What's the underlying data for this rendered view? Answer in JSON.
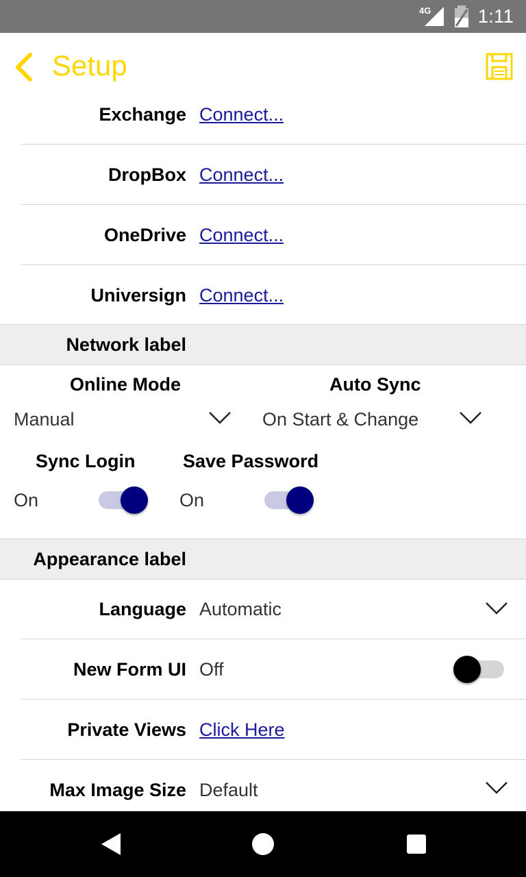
{
  "status_bar": {
    "network": "4G",
    "time": "1:11"
  },
  "app_bar": {
    "title": "Setup"
  },
  "connections": [
    {
      "label": "Exchange",
      "action": "Connect..."
    },
    {
      "label": "DropBox",
      "action": "Connect..."
    },
    {
      "label": "OneDrive",
      "action": "Connect..."
    },
    {
      "label": "Universign",
      "action": "Connect..."
    }
  ],
  "network_section": {
    "label": "Network label",
    "online_mode": {
      "label": "Online Mode",
      "value": "Manual"
    },
    "auto_sync": {
      "label": "Auto Sync",
      "value": "On Start & Change"
    },
    "sync_login": {
      "label": "Sync Login",
      "value": "On",
      "checked": true
    },
    "save_password": {
      "label": "Save Password",
      "value": "On",
      "checked": true
    }
  },
  "appearance_section": {
    "label": "Appearance label",
    "language": {
      "label": "Language",
      "value": "Automatic"
    },
    "new_form_ui": {
      "label": "New Form UI",
      "value": "Off",
      "checked": false
    },
    "private_views": {
      "label": "Private Views",
      "action": "Click Here"
    },
    "max_image_size": {
      "label": "Max Image Size",
      "value": "Default"
    }
  },
  "colors": {
    "accent": "#FFD700",
    "link": "#1a1a9a",
    "switch_on": "#00007f",
    "status_bar": "#757575",
    "section_bg": "#eeeeee"
  }
}
